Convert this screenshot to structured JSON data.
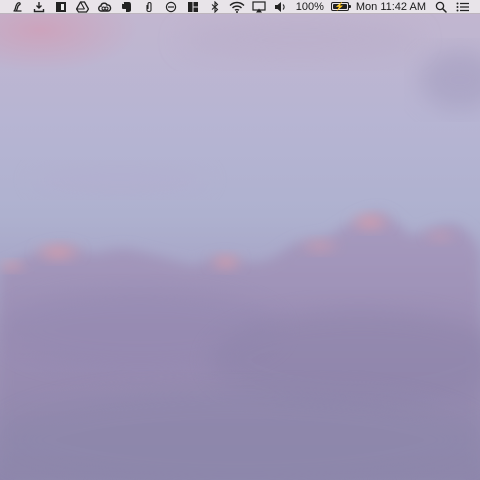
{
  "menubar": {
    "icons": [
      "script-editor-icon",
      "download-icon",
      "window-manager-icon",
      "google-drive-icon",
      "creative-cloud-icon",
      "evernote-icon",
      "paperclip-icon",
      "sync-icon",
      "layout-grid-icon",
      "bluetooth-icon",
      "wifi-icon",
      "airplay-icon",
      "volume-icon"
    ],
    "battery": {
      "percent_label": "100%",
      "level": 1.0,
      "charging": true
    },
    "clock": "Mon 11:42 AM",
    "spotlight_icon": "search-icon",
    "notification_icon": "notification-center-icon"
  },
  "desktop": {
    "wallpaper": "pink-purple cloudy sky"
  }
}
